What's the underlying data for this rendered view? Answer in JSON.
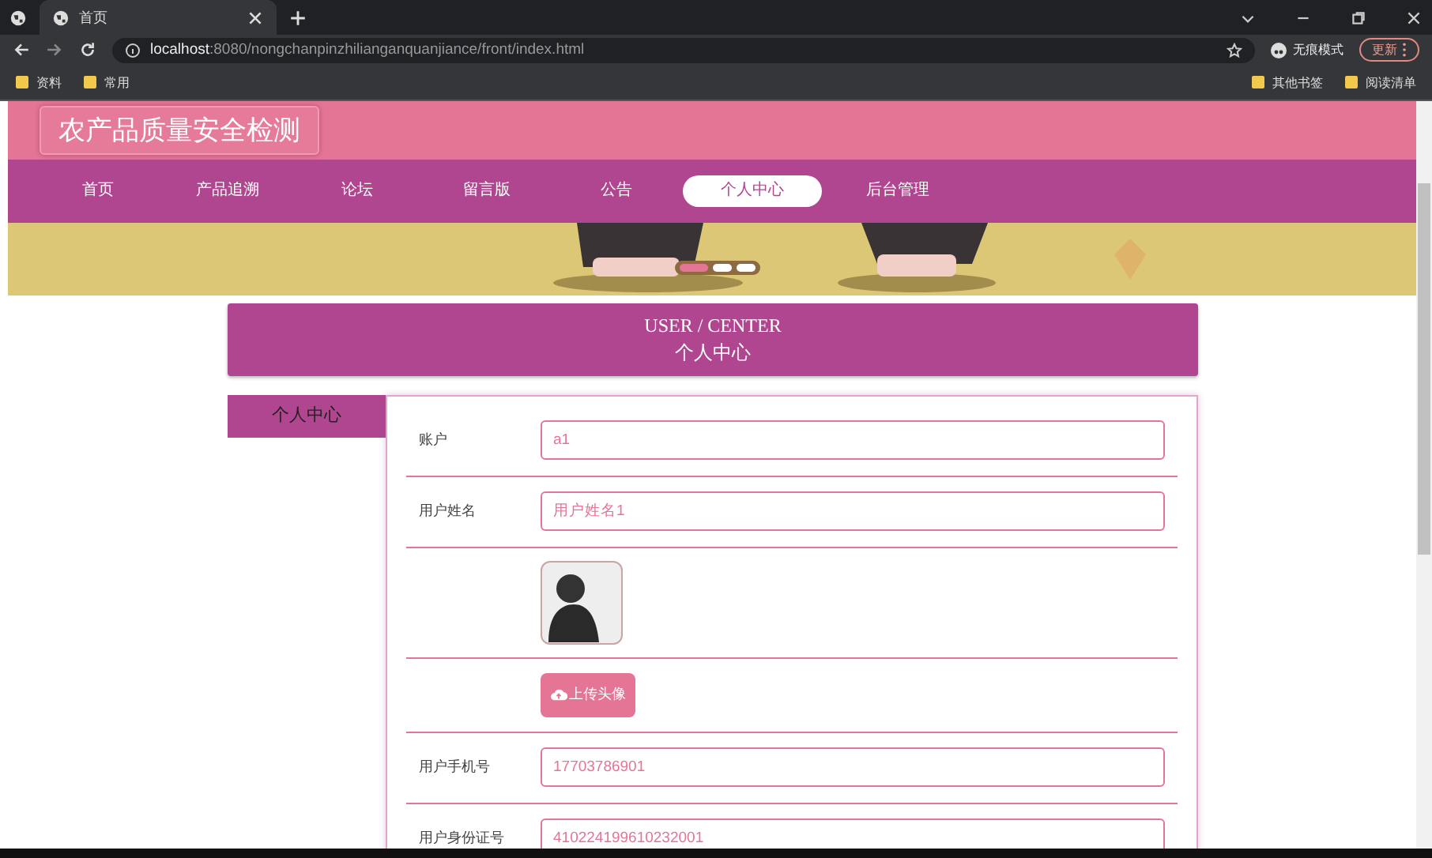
{
  "browser": {
    "tabs": [
      {
        "title": "首页",
        "selected": true
      }
    ],
    "url_host": "localhost",
    "url_rest": ":8080/nongchanpinzhilianganquanjiance/front/index.html",
    "incognito": "无痕模式",
    "update": "更新",
    "bookmarks": [
      "资料",
      "常用"
    ],
    "bookmarks_right": [
      "其他书签",
      "阅读清单"
    ]
  },
  "site": {
    "title": "农产品质量安全检测",
    "nav": [
      {
        "label": "首页",
        "selected": false
      },
      {
        "label": "产品追溯",
        "selected": false
      },
      {
        "label": "论坛",
        "selected": false
      },
      {
        "label": "留言版",
        "selected": false
      },
      {
        "label": "公告",
        "selected": false
      },
      {
        "label": "个人中心",
        "selected": true
      },
      {
        "label": "后台管理",
        "selected": false
      }
    ],
    "banner_dots": [
      {
        "selected": true
      },
      {
        "selected": false
      },
      {
        "selected": false
      }
    ],
    "section_title_en": "USER / CENTER",
    "section_title": "个人中心",
    "side_menu": [
      {
        "label": "个人中心",
        "selected": true
      }
    ],
    "form": [
      {
        "kind": "input",
        "label": "账户",
        "value": "a1"
      },
      {
        "kind": "input",
        "label": "用户姓名",
        "value": "用户姓名1"
      },
      {
        "kind": "image"
      },
      {
        "kind": "button",
        "text": "上传头像"
      },
      {
        "kind": "input",
        "label": "用户手机号",
        "value": "17703786901"
      },
      {
        "kind": "input",
        "label": "用户身份证号",
        "value": "410224199610232001"
      }
    ]
  }
}
